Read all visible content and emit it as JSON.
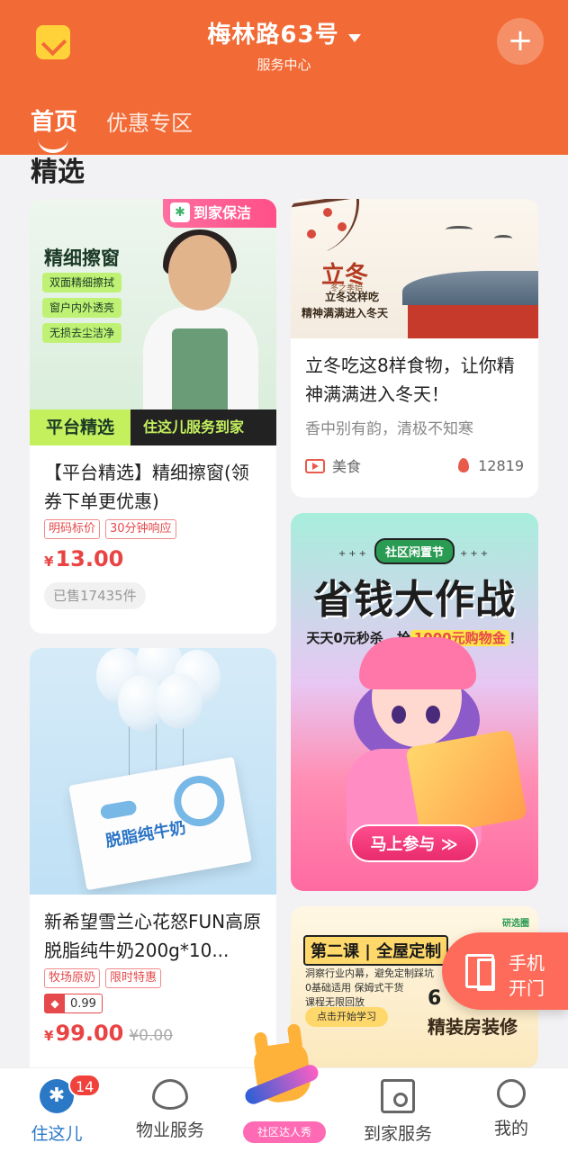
{
  "header": {
    "title": "梅林路63号",
    "subtitle": "服务中心",
    "tabs": [
      {
        "label": "首页",
        "active": true
      },
      {
        "label": "优惠专区",
        "active": false
      }
    ],
    "accent_color": "#f26a35"
  },
  "section_title": "精选",
  "cards": {
    "cleaning": {
      "image": {
        "badge": "到家保洁",
        "headline": "精细擦窗",
        "features": [
          "双面精细擦拭",
          "窗户内外透亮",
          "无损去尘洁净"
        ],
        "bottom_left": "平台精选",
        "bottom_right": "住这儿服务到家"
      },
      "title": "【平台精选】精细擦窗(领券下单更优惠)",
      "tags": [
        "明码标价",
        "30分钟响应"
      ],
      "currency": "¥",
      "price": "13.00",
      "sold": "已售17435件"
    },
    "article": {
      "image": {
        "big": "立冬",
        "small": "冬之季始",
        "line1": "立冬这样吃",
        "line2": "精神满满进入冬天"
      },
      "title": "立冬吃这8样食物，让你精神满满进入冬天！",
      "subtitle": "香中别有韵，清极不知寒",
      "category": "美食",
      "hot_count": "12819"
    },
    "promo": {
      "pill": "社区闲置节",
      "headline": "省钱大作战",
      "line_prefix": "天天0元秒杀，抢",
      "line_highlight": "1000元购物金",
      "line_suffix": "！",
      "button": "马上参与 ≫"
    },
    "milk": {
      "image": {
        "box_text": "脱脂纯牛奶"
      },
      "title": "新希望雪兰心花怒FUN高原脱脂纯牛奶200g*10...",
      "tags": [
        "牧场原奶",
        "限时特惠"
      ],
      "rating": "0.99",
      "currency": "¥",
      "price": "99.00",
      "original_price": "¥0.00"
    },
    "course": {
      "logo": "研选圈",
      "headline": "第二课 | 全屋定制",
      "lines": [
        "洞察行业内幕，避免定制踩坑",
        "0基础适用  保姆式干货",
        "课程无限回放"
      ],
      "learn": "点击开始学习",
      "big_text": "6",
      "big_text2": "精装房装修"
    }
  },
  "floating": {
    "label_line1": "手机",
    "label_line2": "开门"
  },
  "bottom_nav": {
    "items": [
      {
        "label": "住这儿",
        "badge": "14",
        "icon": "home-icon",
        "active": true
      },
      {
        "label": "物业服务",
        "icon": "heart-icon"
      },
      {
        "label": "社区达人秀",
        "icon": "rock-hand-icon"
      },
      {
        "label": "到家服务",
        "icon": "house-icon"
      },
      {
        "label": "我的",
        "icon": "user-icon"
      }
    ],
    "active_color": "#2a78c6"
  }
}
